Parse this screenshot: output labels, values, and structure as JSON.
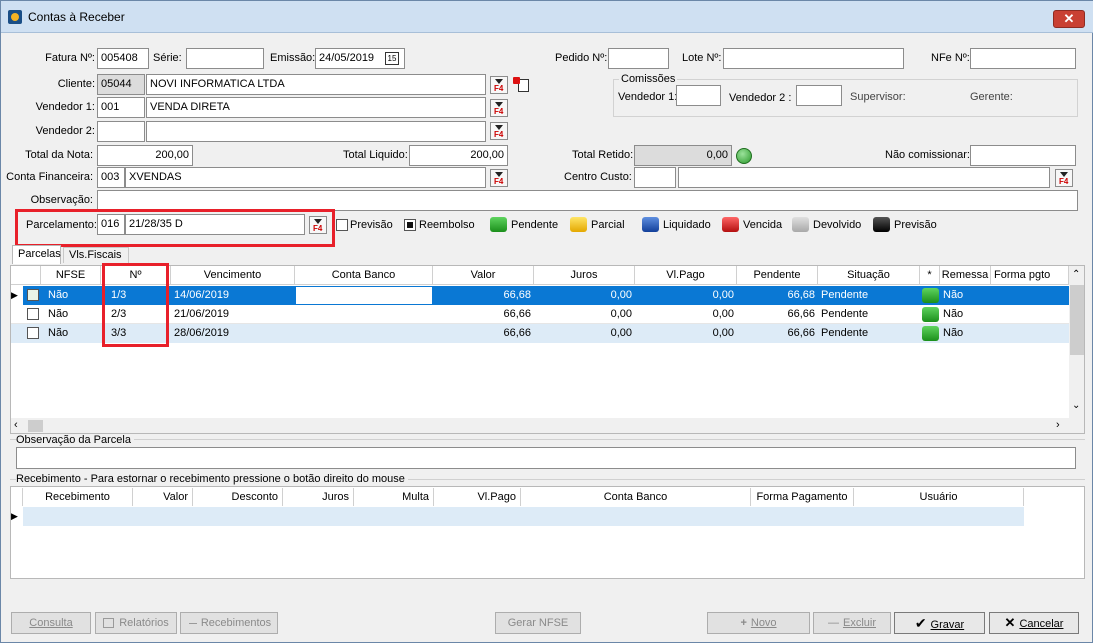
{
  "window": {
    "title": "Contas à Receber",
    "close": "✕"
  },
  "header": {
    "fatura_label": "Fatura Nº:",
    "fatura": "005408",
    "serie_label": "Série:",
    "serie": "",
    "emissao_label": "Emissão:",
    "emissao": "24/05/2019",
    "emissao_icon": "15",
    "pedido_label": "Pedido Nº:",
    "pedido": "",
    "lote_label": "Lote Nº:",
    "lote": "",
    "nfe_label": "NFe Nº:",
    "nfe": "",
    "cliente_label": "Cliente:",
    "cliente_code": "05044",
    "cliente_name": "NOVI INFORMATICA LTDA",
    "vendedor1_label": "Vendedor 1:",
    "vendedor1_code": "001",
    "vendedor1_name": "VENDA DIRETA",
    "vendedor2_label": "Vendedor 2:",
    "vendedor2_code": "",
    "vendedor2_name": "",
    "total_nota_label": "Total da Nota:",
    "total_nota": "200,00",
    "total_liquido_label": "Total Liquido:",
    "total_liquido": "200,00",
    "total_retido_label": "Total Retido:",
    "total_retido": "0,00",
    "nao_comissionar_label": "Não comissionar:",
    "nao_comissionar": "",
    "conta_label": "Conta Financeira:",
    "conta_code": "003",
    "conta_name": "XVENDAS",
    "centro_label": "Centro Custo:",
    "centro_code": "",
    "centro_name": "",
    "obs_label": "Observação:",
    "obs": "",
    "parcelamento_label": "Parcelamento:",
    "parc_code": "016",
    "parc_desc": "21/28/35 D"
  },
  "comissoes": {
    "title": "Comissões",
    "v1": "Vendedor 1:",
    "v2": "Vendedor 2 :",
    "sup": "Supervisor:",
    "ger": "Gerente:"
  },
  "legend": {
    "previsao_chk": "Previsão",
    "reembolso_chk": "Reembolso",
    "pendente": "Pendente",
    "parcial": "Parcial",
    "liquidado": "Liquidado",
    "vencida": "Vencida",
    "devolvido": "Devolvido",
    "previsao": "Previsão",
    "colors": {
      "pendente": "#1b8f1b",
      "parcial": "#e4a800",
      "liquidado": "#123f9a",
      "vencida": "#b40f0f",
      "devolvido": "#a8a8a8",
      "previsao": "#000000"
    }
  },
  "tabs": {
    "parcelas": "Parcelas",
    "fiscais": "Vls.Fiscais"
  },
  "parcelas": {
    "columns": [
      "NFSE",
      "Nº",
      "Vencimento",
      "Conta Banco",
      "Valor",
      "Juros",
      "Vl.Pago",
      "Pendente",
      "Situação",
      "*",
      "Remessa",
      "Forma pgto"
    ],
    "rows": [
      {
        "nfse": "Não",
        "num": "1/3",
        "venc": "14/06/2019",
        "banco": "",
        "valor": "66,68",
        "juros": "0,00",
        "pago": "0,00",
        "pend": "66,68",
        "sit": "Pendente",
        "rem": "Não",
        "forma": ""
      },
      {
        "nfse": "Não",
        "num": "2/3",
        "venc": "21/06/2019",
        "banco": "",
        "valor": "66,66",
        "juros": "0,00",
        "pago": "0,00",
        "pend": "66,66",
        "sit": "Pendente",
        "rem": "Não",
        "forma": ""
      },
      {
        "nfse": "Não",
        "num": "3/3",
        "venc": "28/06/2019",
        "banco": "",
        "valor": "66,66",
        "juros": "0,00",
        "pago": "0,00",
        "pend": "66,66",
        "sit": "Pendente",
        "rem": "Não",
        "forma": ""
      }
    ]
  },
  "obs_parcela": {
    "title": "Observação da Parcela",
    "value": ""
  },
  "recebimento": {
    "title": "Recebimento - Para estornar o recebimento pressione o botão direito do mouse",
    "columns": [
      "Recebimento",
      "Valor",
      "Desconto",
      "Juros",
      "Multa",
      "Vl.Pago",
      "Conta Banco",
      "Forma Pagamento",
      "Usuário"
    ]
  },
  "buttons": {
    "consulta": "Consulta",
    "relatorios": "Relatórios",
    "recebimentos": "Recebimentos",
    "gerar_nfse": "Gerar NFSE",
    "novo": "Novo",
    "excluir": "Excluir",
    "gravar": "Gravar",
    "cancelar": "Cancelar"
  }
}
